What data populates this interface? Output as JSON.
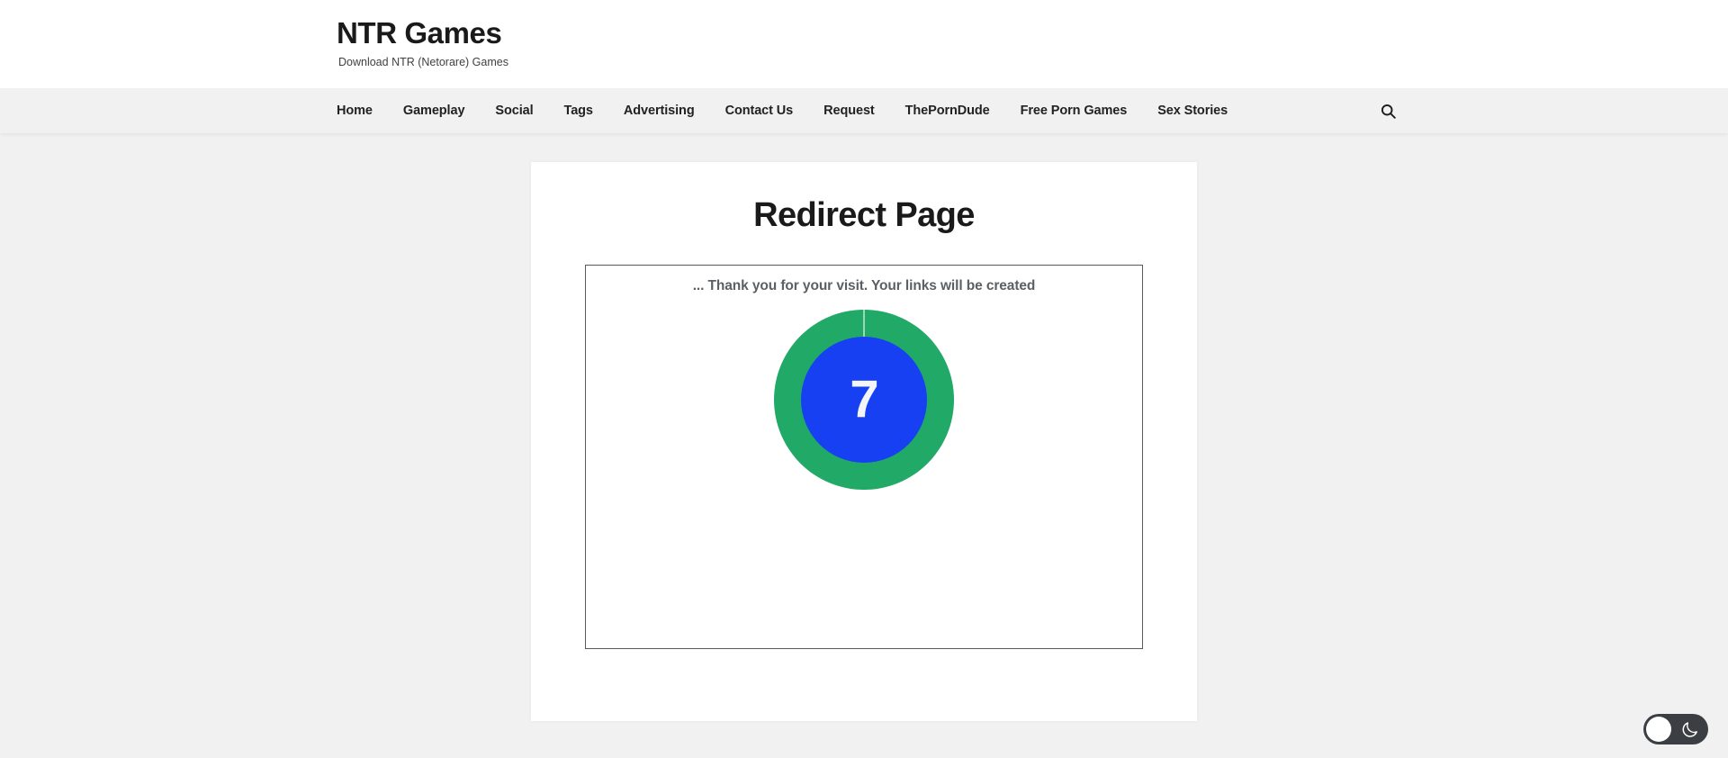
{
  "header": {
    "site_title": "NTR Games",
    "tagline": "Download NTR (Netorare) Games"
  },
  "nav": {
    "items": [
      {
        "label": "Home"
      },
      {
        "label": "Gameplay"
      },
      {
        "label": "Social"
      },
      {
        "label": "Tags"
      },
      {
        "label": "Advertising"
      },
      {
        "label": "Contact Us"
      },
      {
        "label": "Request"
      },
      {
        "label": "ThePornDude"
      },
      {
        "label": "Free Porn Games"
      },
      {
        "label": "Sex Stories"
      }
    ],
    "search_icon": "search-icon"
  },
  "main": {
    "page_title": "Redirect Page",
    "redirect_message": "... Thank you for your visit. Your links will be created",
    "countdown": {
      "value": "7",
      "ring_color": "#21a967",
      "inner_color": "#1740f2",
      "number_color": "#f4f5f8"
    }
  },
  "footer": {
    "dark_mode_toggle": {
      "state": "light",
      "icon": "moon-icon"
    }
  }
}
